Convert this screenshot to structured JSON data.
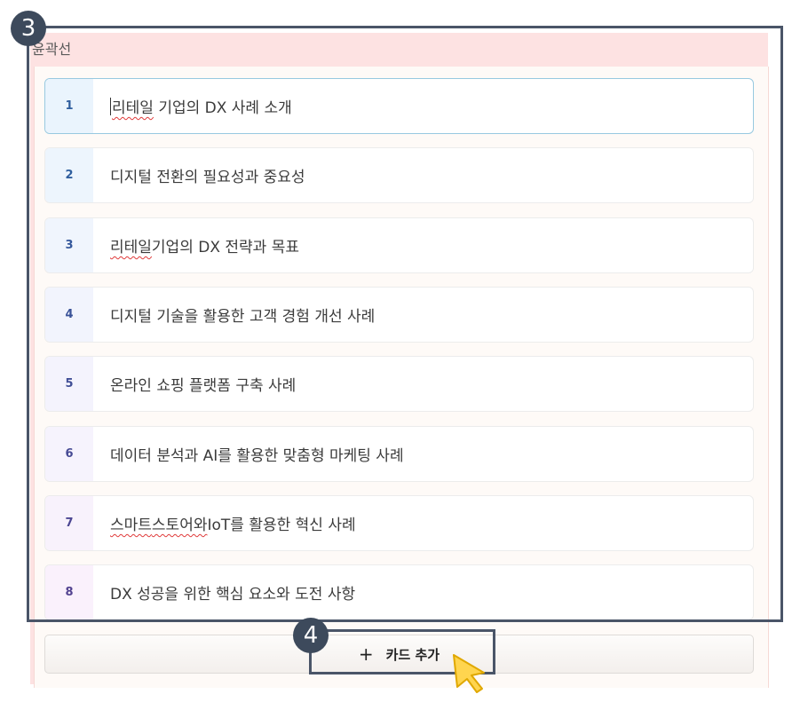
{
  "outline": {
    "title": "윤곽선",
    "cards": [
      {
        "number": "1",
        "text": "리테일 기업의 DX 사례 소개",
        "num_bg": "#eaf4fd",
        "num_color": "#2f5e9e"
      },
      {
        "number": "2",
        "text": "디지털 전환의 필요성과 중요성",
        "num_bg": "#edf5fd",
        "num_color": "#2f5e9e"
      },
      {
        "number": "3",
        "text": "리테일 기업의 DX 전략과 목표",
        "num_bg": "#f0f5fd",
        "num_color": "#34579b"
      },
      {
        "number": "4",
        "text": "디지털 기술을 활용한 고객 경험 개선 사례",
        "num_bg": "#f2f4fd",
        "num_color": "#3a5298"
      },
      {
        "number": "5",
        "text": "온라인 쇼핑 플랫폼 구축 사례",
        "num_bg": "#f4f3fd",
        "num_color": "#404e96"
      },
      {
        "number": "6",
        "text": "데이터 분석과 AI를 활용한 맞춤형 마케팅 사례",
        "num_bg": "#f6f3fd",
        "num_color": "#464a94"
      },
      {
        "number": "7",
        "text": "스마트 스토어와 IoT를 활용한 혁신 사례",
        "num_bg": "#f8f2fc",
        "num_color": "#4c4692"
      },
      {
        "number": "8",
        "text": "DX 성공을 위한 핵심 요소와 도전 사항",
        "num_bg": "#faf1fc",
        "num_color": "#524290"
      }
    ],
    "add_card_label": "카드 추가",
    "add_icon": "plus-icon"
  },
  "annotations": {
    "badge_3": "3",
    "badge_4": "4"
  },
  "colors": {
    "panel_bg": "#fde2e2",
    "highlight": "#4a5568",
    "cursor": "#ffd54f"
  }
}
